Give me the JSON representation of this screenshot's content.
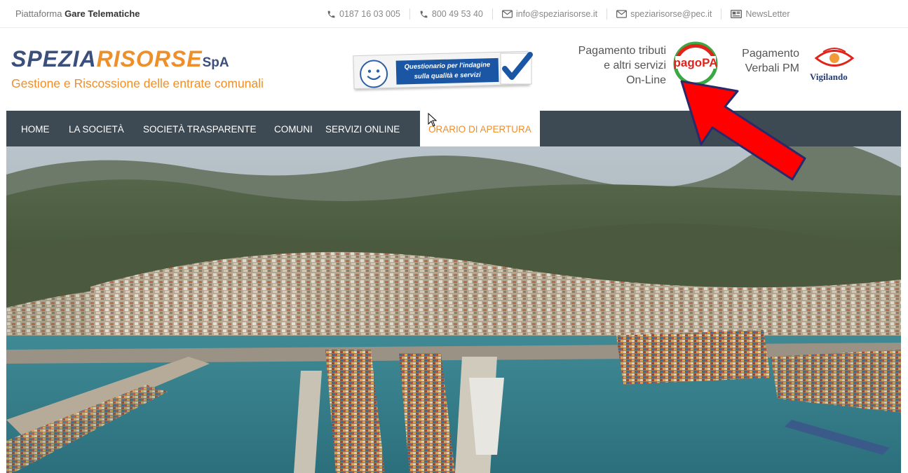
{
  "topbar": {
    "platform_prefix": "Piattaforma",
    "platform_bold": "Gare Telematiche",
    "contacts": [
      {
        "icon": "phone-icon",
        "text": "0187 16 03 005"
      },
      {
        "icon": "phone-icon",
        "text": "800 49 53 40"
      },
      {
        "icon": "mail-icon",
        "text": "info@speziarisorse.it"
      },
      {
        "icon": "mail-icon",
        "text": "speziarisorse@pec.it"
      },
      {
        "icon": "newspaper-icon",
        "text": "NewsLetter"
      }
    ]
  },
  "logo": {
    "part1": "SPEZIA",
    "part2": "RISORSE",
    "part3": "SpA",
    "tagline": "Gestione e Riscossione delle entrate comunali"
  },
  "questionnaire": {
    "line1": "Questionario per l'indagine",
    "line2": "sulla qualità e servizi"
  },
  "pagopa": {
    "line1": "Pagamento tributi",
    "line2": "e altri servizi",
    "line3": "On-Line",
    "logo_text": "pagoPA"
  },
  "verbali": {
    "line1": "Pagamento",
    "line2": "Verbali PM",
    "brand": "Vigilando"
  },
  "nav": {
    "items": [
      "HOME",
      "LA SOCIETÀ",
      "SOCIETÀ TRASPARENTE",
      "COMUNI",
      "SERVIZI ONLINE",
      "ORARIO DI APERTURA"
    ],
    "active_index": 5
  },
  "colors": {
    "brand_blue": "#3b4f7c",
    "accent_orange": "#ef8f2a",
    "nav_bg": "#3d4a53",
    "arrow_red": "#ff0000"
  }
}
